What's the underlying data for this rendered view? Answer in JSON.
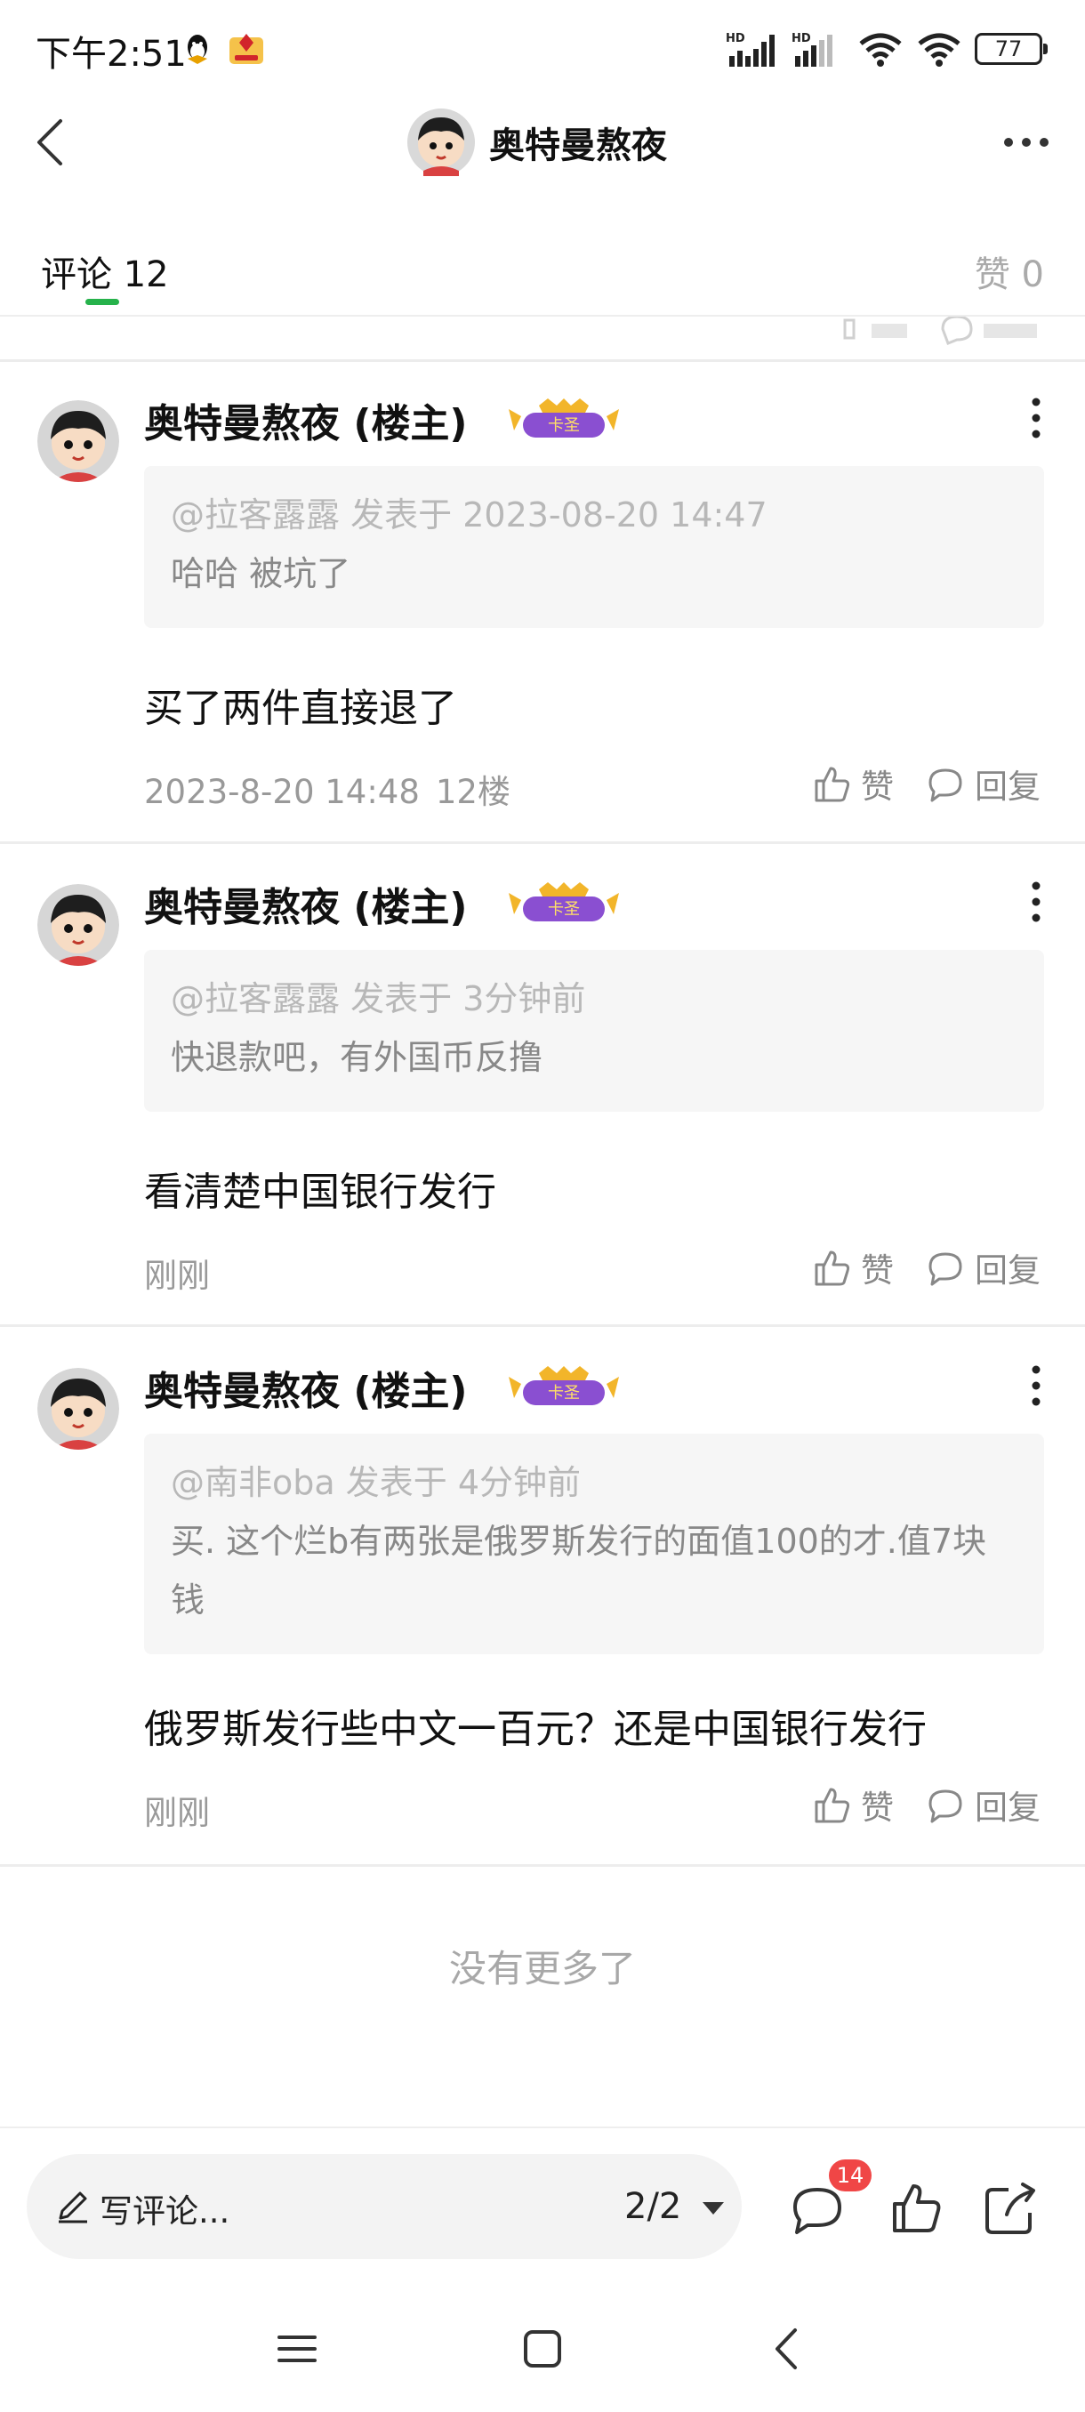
{
  "status_bar": {
    "time": "下午2:51",
    "battery": "77"
  },
  "header": {
    "title": "奥特曼熬夜"
  },
  "tabs": {
    "comments_label": "评论",
    "comments_count": "12",
    "likes_label": "赞",
    "likes_count": "0"
  },
  "comments": [
    {
      "author": "奥特曼熬夜",
      "role": "(楼主)",
      "badge_text": "卡圣",
      "quote": {
        "user": "@拉客露露",
        "time_prefix": "发表于",
        "time": "2023-08-20 14:47",
        "text": "哈哈 被坑了"
      },
      "text": "买了两件直接退了",
      "time": "2023-8-20 14:48",
      "floor": "12楼",
      "like_label": "赞",
      "reply_label": "回复"
    },
    {
      "author": "奥特曼熬夜",
      "role": "(楼主)",
      "badge_text": "卡圣",
      "quote": {
        "user": "@拉客露露",
        "time_prefix": "发表于",
        "time": "3分钟前",
        "text": "快退款吧，有外国币反撸"
      },
      "text": "看清楚中国银行发行",
      "time": "刚刚",
      "floor": "",
      "like_label": "赞",
      "reply_label": "回复"
    },
    {
      "author": "奥特曼熬夜",
      "role": "(楼主)",
      "badge_text": "卡圣",
      "quote": {
        "user": "@南非oba",
        "time_prefix": "发表于",
        "time": "4分钟前",
        "text": "买. 这个烂b有两张是俄罗斯发行的面值100的才.值7块钱"
      },
      "text": "俄罗斯发行些中文一百元？还是中国银行发行",
      "time": "刚刚",
      "floor": "",
      "like_label": "赞",
      "reply_label": "回复"
    }
  ],
  "footer": {
    "no_more": "没有更多了"
  },
  "bottom_bar": {
    "write_placeholder": "写评论...",
    "page_indicator": "2/2",
    "message_badge": "14"
  },
  "colors": {
    "accent_green": "#26b24b",
    "badge_red": "#f04646",
    "badge_purple": "#8a4fd1"
  }
}
